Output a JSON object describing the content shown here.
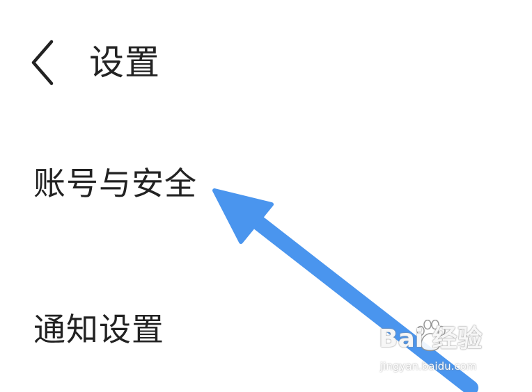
{
  "header": {
    "back_icon": "chevron-left-icon",
    "title": "设置"
  },
  "menu": {
    "items": [
      {
        "label": "账号与安全"
      },
      {
        "label": "通知设置"
      }
    ]
  },
  "annotation": {
    "arrow_color": "#4a95ee",
    "icon": "arrow-up-left-icon"
  },
  "watermark": {
    "brand": "Bai 经验",
    "paw_icon": "baidu-paw-icon",
    "url": "jingyan.baidu.com"
  },
  "colors": {
    "text": "#222222",
    "background": "#ffffff"
  }
}
